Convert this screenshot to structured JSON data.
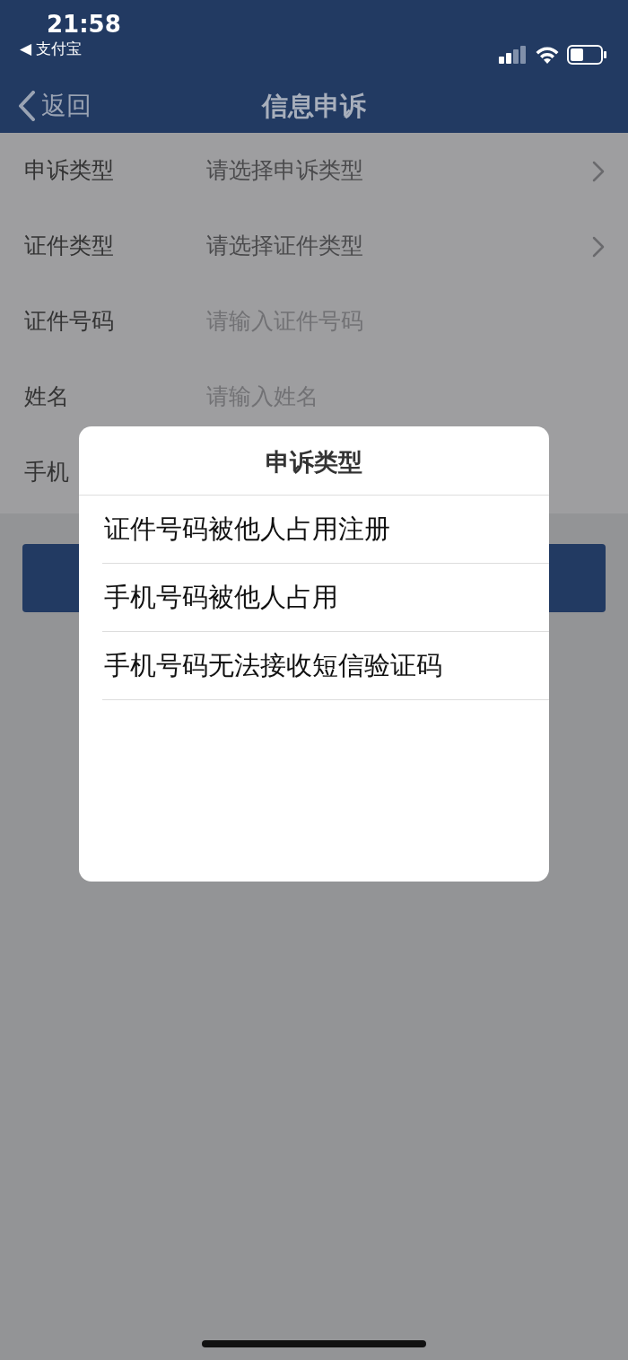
{
  "status_bar": {
    "time": "21:58",
    "back_app": "◀ 支付宝"
  },
  "nav": {
    "back": "返回",
    "title": "信息申诉"
  },
  "form_rows": [
    {
      "label": "申诉类型",
      "kind": "select",
      "text": "请选择申诉类型"
    },
    {
      "label": "证件类型",
      "kind": "select",
      "text": "请选择证件类型"
    },
    {
      "label": "证件号码",
      "kind": "input",
      "placeholder": "请输入证件号码"
    },
    {
      "label": "姓名",
      "kind": "input",
      "placeholder": "请输入姓名"
    },
    {
      "label": "手机",
      "kind": "hidden"
    }
  ],
  "dialog": {
    "title": "申诉类型",
    "options": [
      {
        "label": "证件号码被他人占用注册"
      },
      {
        "label": "手机号码被他人占用"
      },
      {
        "label": "手机号码无法接收短信验证码"
      }
    ]
  }
}
